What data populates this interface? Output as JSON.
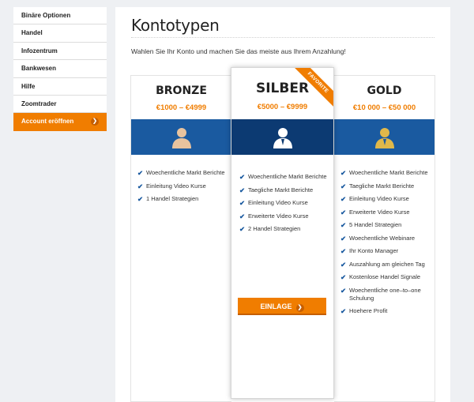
{
  "sidebar": {
    "items": [
      {
        "label": "Binäre Optionen"
      },
      {
        "label": "Handel"
      },
      {
        "label": "Infozentrum"
      },
      {
        "label": "Bankwesen"
      },
      {
        "label": "Hilfe"
      },
      {
        "label": "Zoomtrader"
      },
      {
        "label": "Account eröffnen"
      }
    ]
  },
  "main": {
    "title": "Kontotypen",
    "intro": "Wahlen Sie Ihr Konto und machen Sie das meiste aus Ihrem Anzahlung!"
  },
  "plans": {
    "bronze": {
      "name": "BRONZE",
      "price": "€1000 – €4999",
      "icon": "person-icon",
      "icon_color": "#e8c39e",
      "features": [
        "Woechentliche Markt Berichte",
        "Einleitung Video Kurse",
        "1 Handel Strategien"
      ]
    },
    "silber": {
      "name": "SILBER",
      "price": "€5000 – €9999",
      "ribbon": "FAVORITE",
      "icon": "person-icon",
      "icon_color": "#ffffff",
      "features": [
        "Woechentliche Markt Berichte",
        "Taegliche Markt Berichte",
        "Einleitung Video Kurse",
        "Erweiterte Video Kurse",
        "2 Handel Strategien"
      ],
      "button": "EINLAGE"
    },
    "gold": {
      "name": "GOLD",
      "price": "€10 000 – €50 000",
      "icon": "person-icon",
      "icon_color": "#e0b84a",
      "features": [
        "Woechentliche Markt Berichte",
        "Taegliche Markt Berichte",
        "Einleitung Video Kurse",
        "Erweiterte Video Kurse",
        "5 Handel Strategien",
        "Woechentliche Webinare",
        "Ihr Konto Manager",
        "Auszahlung am gleichen Tag",
        "Kostenlose Handel Signale",
        "Woechentliche one–to–one Schulung",
        "Hoehere Profit"
      ]
    }
  },
  "colors": {
    "accent": "#f07d00",
    "band_blue": "#1a5aa0",
    "band_dark": "#0c3a72",
    "check": "#1a5aa0"
  }
}
